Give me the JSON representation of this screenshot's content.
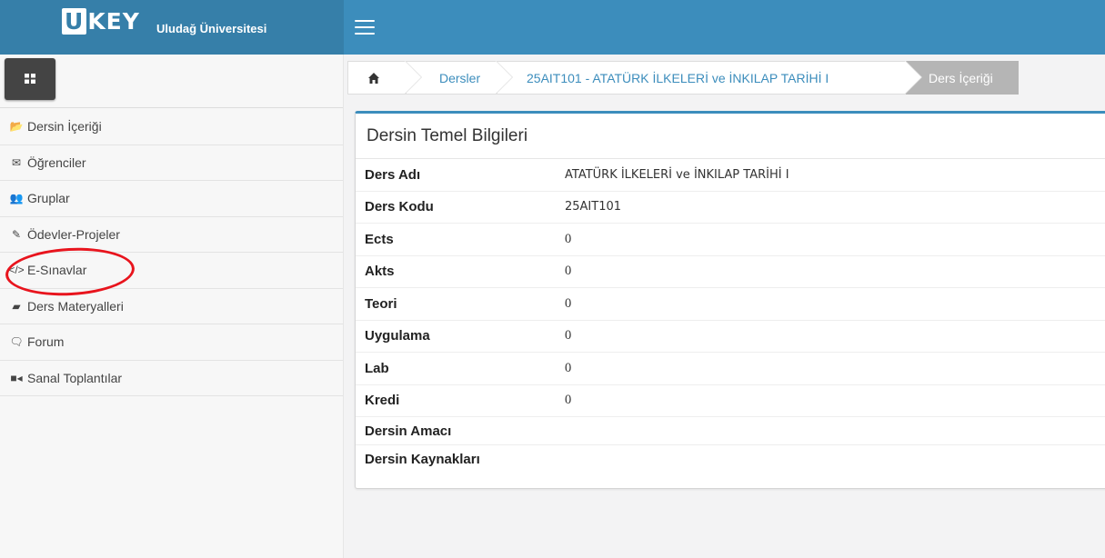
{
  "header": {
    "logo_u": "U",
    "logo_rest": "KEY",
    "university": "Uludağ Üniversitesi"
  },
  "sidebar": {
    "items": [
      {
        "label": "Dersin İçeriği",
        "icon": "folder-open-icon",
        "glyph": "📂"
      },
      {
        "label": " Öğrenciler",
        "icon": "envelope-icon",
        "glyph": "✉"
      },
      {
        "label": "Gruplar",
        "icon": "users-icon",
        "glyph": "👥"
      },
      {
        "label": "Ödevler-Projeler",
        "icon": "edit-icon",
        "glyph": "✎"
      },
      {
        "label": "E-Sınavlar",
        "icon": "code-icon",
        "glyph": "</>"
      },
      {
        "label": "Ders Materyalleri",
        "icon": "book-icon",
        "glyph": "▰"
      },
      {
        "label": "Forum",
        "icon": "comment-icon",
        "glyph": "🗨"
      },
      {
        "label": "Sanal Toplantılar",
        "icon": "video-camera-icon",
        "glyph": "■◂"
      }
    ],
    "highlighted": "E-Sınavlar",
    "highlight_color": "#e8141d"
  },
  "breadcrumb": {
    "items": [
      "Dersler",
      "25AIT101 - ATATÜRK İLKELERİ ve İNKILAP TARİHİ I",
      "Ders İçeriği"
    ]
  },
  "panel": {
    "title": "Dersin Temel Bilgileri",
    "rows": [
      {
        "label": "Ders Adı",
        "value": "ATATÜRK İLKELERİ ve İNKILAP TARİHİ I"
      },
      {
        "label": "Ders Kodu",
        "value": "25AIT101"
      },
      {
        "label": "Ects",
        "value": "0"
      },
      {
        "label": "Akts",
        "value": "0"
      },
      {
        "label": "Teori",
        "value": "0"
      },
      {
        "label": "Uygulama",
        "value": "0"
      },
      {
        "label": "Lab",
        "value": "0"
      },
      {
        "label": "Kredi",
        "value": "0"
      },
      {
        "label": "Dersin Amacı",
        "value": ""
      },
      {
        "label": "Dersin Kaynakları",
        "value": ""
      }
    ]
  },
  "colors": {
    "header": "#3c8dbc",
    "brand": "#367fa9",
    "active_crumb": "#b5b5b5"
  }
}
